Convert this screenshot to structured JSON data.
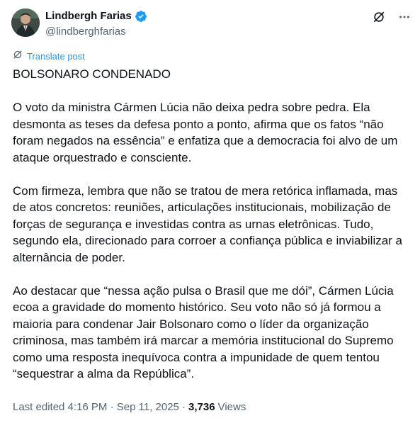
{
  "author": {
    "name": "Lindbergh Farias",
    "handle": "@lindberghfarias",
    "verified": true
  },
  "colors": {
    "accent": "#1d9bf0",
    "text": "#0f1419",
    "muted": "#536471"
  },
  "icons": {
    "verified": "verified-badge-icon",
    "grok": "grok-icon",
    "more": "more-icon",
    "translate": "translate-icon"
  },
  "translate_label": "Translate post",
  "post": {
    "paragraphs": [
      "BOLSONARO CONDENADO",
      "O voto da ministra Cármen Lúcia não deixa pedra sobre pedra. Ela desmonta as teses da defesa ponto a ponto, afirma que os fatos “não foram negados na essência” e enfatiza que a democracia foi alvo de um ataque orquestrado e consciente.",
      "Com firmeza, lembra que não se tratou de mera retórica inflamada, mas de atos concretos: reuniões, articulações institucionais, mobilização de forças de segurança e investidas contra as urnas eletrônicas. Tudo, segundo ela, direcionado para corroer a confiança pública e inviabilizar a alternância de poder.",
      "Ao destacar que “nessa ação pulsa o Brasil que me dói”, Cármen Lúcia ecoa a gravidade do momento histórico. Seu voto não só já formou a maioria para condenar Jair Bolsonaro como o líder da organização criminosa, mas também irá marcar a memória institucional do Supremo como uma resposta inequívoca contra a impunidade de quem tentou “sequestrar a alma da República”."
    ]
  },
  "meta": {
    "edited": "Last edited 4:16 PM · Sep 11, 2025 ·",
    "views_count": "3,736",
    "views_label": "Views"
  }
}
